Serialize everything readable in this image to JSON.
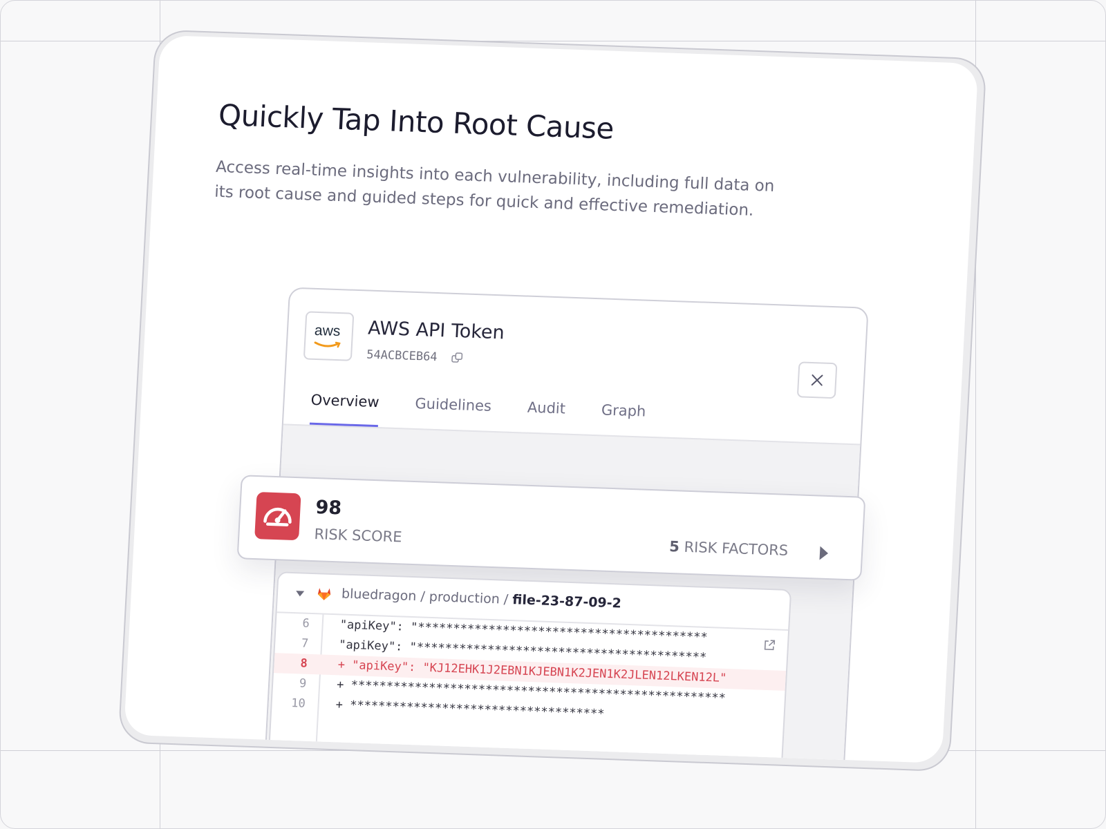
{
  "header": {
    "title": "Quickly Tap Into Root Cause",
    "description": "Access real-time insights into each vulnerability, including full data on its root cause and guided steps for quick and effective remediation."
  },
  "token": {
    "logo_text": "aws",
    "name": "AWS API Token",
    "id": "54ACBCEB64"
  },
  "tabs": [
    {
      "label": "Overview",
      "active": true
    },
    {
      "label": "Guidelines",
      "active": false
    },
    {
      "label": "Audit",
      "active": false
    },
    {
      "label": "Graph",
      "active": false
    }
  ],
  "risk": {
    "score": "98",
    "label": "RISK SCORE",
    "factors_count": "5",
    "factors_label": "RISK FACTORS"
  },
  "file": {
    "repo": "bluedragon",
    "branch": "production",
    "filename": "file-23-87-09-2",
    "lines": [
      {
        "num": "6",
        "text": " \"apiKey\": \"*****************************************",
        "highlight": false
      },
      {
        "num": "7",
        "text": " \"apiKey\": \"*****************************************",
        "highlight": false
      },
      {
        "num": "8",
        "text": "+ \"apiKey\": \"KJ12EHK1J2EBN1KJEBN1K2JEN1K2JLEN12LKEN12L\"",
        "highlight": true
      },
      {
        "num": "9",
        "text": "+ *****************************************************",
        "highlight": false
      },
      {
        "num": "10",
        "text": "+ ************************************",
        "highlight": false
      }
    ]
  },
  "colors": {
    "accent": "#6a68e8",
    "danger": "#d64552",
    "text_primary": "#1c1c2e",
    "text_muted": "#6b6b7d"
  }
}
